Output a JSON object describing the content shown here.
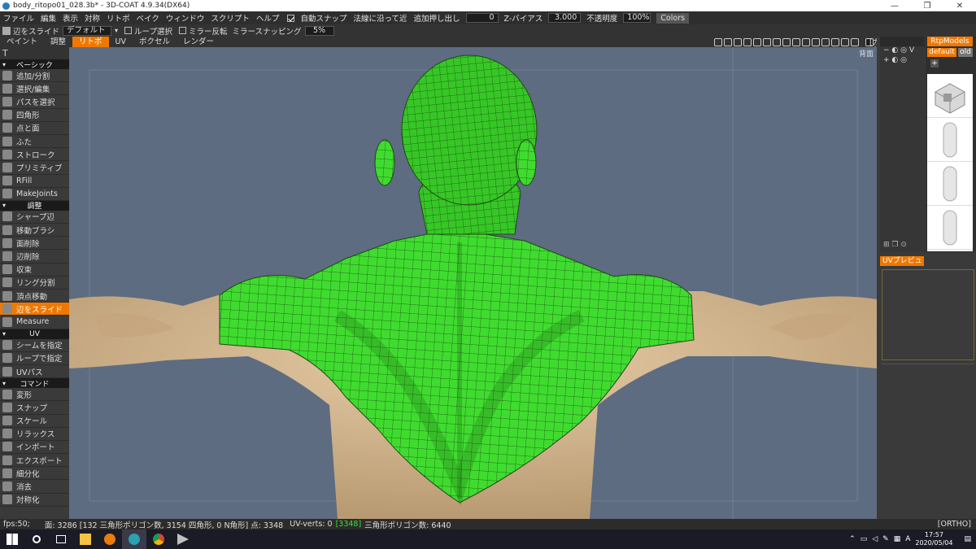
{
  "window": {
    "title": "body_ritopo01_028.3b* - 3D-COAT 4.9.34(DX64)",
    "minimize": "—",
    "maximize": "❐",
    "close": "✕"
  },
  "menu": {
    "items": [
      "ファイル",
      "編集",
      "表示",
      "対称",
      "リトポ",
      "ベイク",
      "ウィンドウ",
      "スクリプト",
      "ヘルプ"
    ],
    "auto_snap": "自動スナップ",
    "normal_mode": "法線に沿って近",
    "add_extrude": "追加押し出し",
    "add_extrude_value": "0",
    "z_bias": "Z-バイアス",
    "z_bias_value": "3.000",
    "opacity": "不透明度",
    "opacity_value": "100%",
    "colors": "Colors"
  },
  "options": {
    "tool_name": "辺をスライド",
    "preset": "デフォルト",
    "loop_select": "ループ選択",
    "mirror": "ミラー反転",
    "mirror_snap": "ミラースナッピング",
    "mirror_snap_value": "5%"
  },
  "rooms": {
    "tabs": [
      "ペイント",
      "調整",
      "リトポ",
      "UV",
      "ボクセル",
      "レンダー"
    ],
    "active": "リトポ",
    "camera": "[カメラ..."
  },
  "toolpanel": {
    "header": "T",
    "sections": [
      {
        "title": "ベーシック",
        "tools": [
          "追加/分割",
          "選択/編集",
          "パスを選択",
          "四角形",
          "点と面",
          "ふた",
          "ストローク",
          "プリミティブ",
          "RFill",
          "MakeJoints"
        ]
      },
      {
        "title": "調整",
        "tools": [
          "シャープ辺",
          "移動ブラシ",
          "面削除",
          "辺削除",
          "収束",
          "リング分割",
          "頂点移動",
          "辺をスライド",
          "Measure"
        ]
      },
      {
        "title": "UV",
        "tools": [
          "シームを指定",
          "ループで指定",
          "UVパス"
        ]
      },
      {
        "title": "コマンド",
        "tools": [
          "変形",
          "スナップ",
          "スケール",
          "リラックス",
          "インポート",
          "エクスポート",
          "細分化",
          "消去",
          "対称化"
        ]
      }
    ],
    "active_tool": "辺をスライド"
  },
  "viewport": {
    "view_label": "背面",
    "colors": {
      "background": "#5d6c80",
      "skin": "#d9be98",
      "mesh": "#3fdc2f",
      "wire": "#1e4a12"
    }
  },
  "right": {
    "models_tab": "RtpModels",
    "sub_default": "default",
    "sub_old": "old",
    "plus": "+",
    "uv_preview": "UVプレビュー"
  },
  "status": {
    "fps": "fps:50;",
    "faces": "面: 3286 [132 三角形ポリゴン数, 3154 四角形, 0 N角形] 点: 3348",
    "uv_verts": "UV-verts: 0",
    "uv_count": "[3348]",
    "tri_count": "三角形ポリゴン数: 6440",
    "ortho": "[ORTHO]"
  },
  "taskbar": {
    "time": "17:57",
    "date": "2020/05/04",
    "ime": "A"
  }
}
